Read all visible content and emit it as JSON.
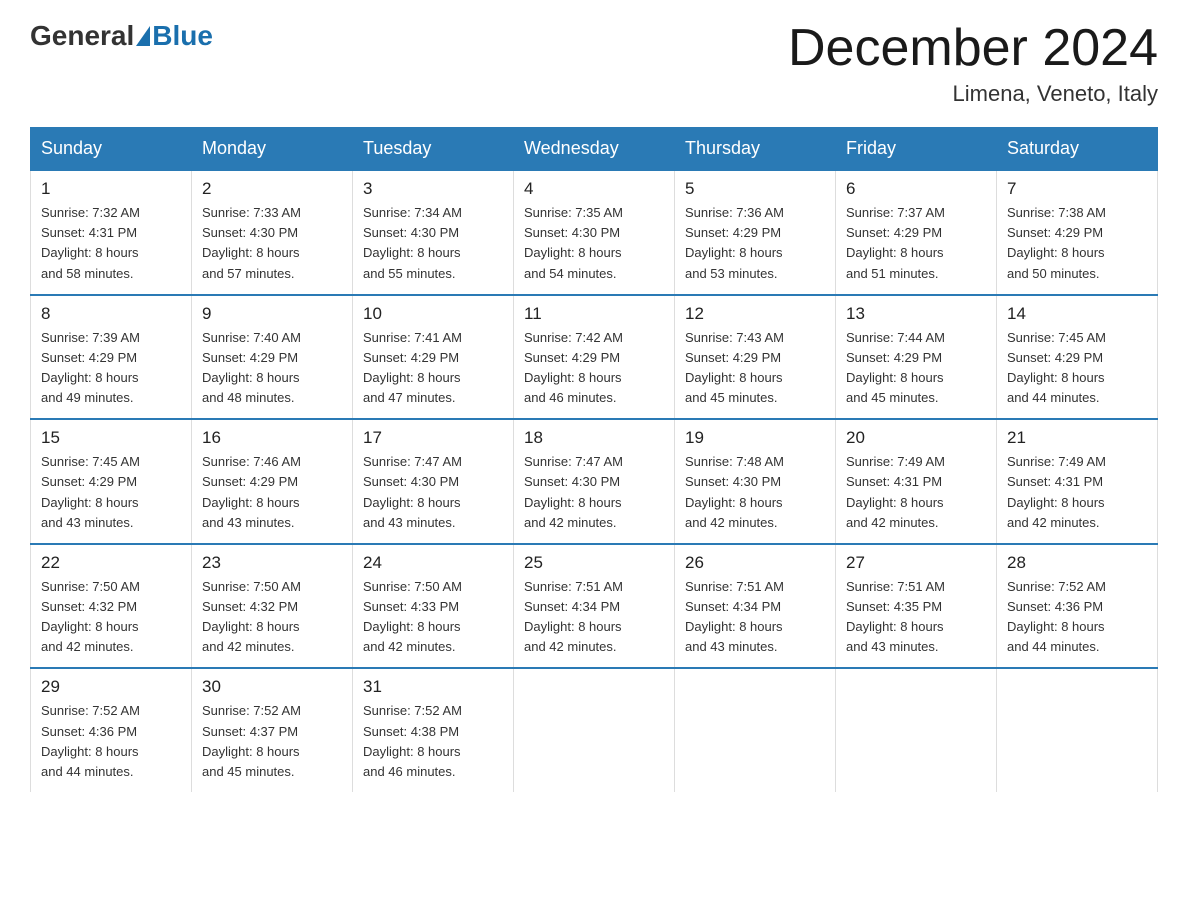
{
  "logo": {
    "general": "General",
    "blue": "Blue"
  },
  "header": {
    "title": "December 2024",
    "subtitle": "Limena, Veneto, Italy"
  },
  "days_of_week": [
    "Sunday",
    "Monday",
    "Tuesday",
    "Wednesday",
    "Thursday",
    "Friday",
    "Saturday"
  ],
  "weeks": [
    [
      {
        "day": "1",
        "sunrise": "7:32 AM",
        "sunset": "4:31 PM",
        "daylight": "8 hours and 58 minutes."
      },
      {
        "day": "2",
        "sunrise": "7:33 AM",
        "sunset": "4:30 PM",
        "daylight": "8 hours and 57 minutes."
      },
      {
        "day": "3",
        "sunrise": "7:34 AM",
        "sunset": "4:30 PM",
        "daylight": "8 hours and 55 minutes."
      },
      {
        "day": "4",
        "sunrise": "7:35 AM",
        "sunset": "4:30 PM",
        "daylight": "8 hours and 54 minutes."
      },
      {
        "day": "5",
        "sunrise": "7:36 AM",
        "sunset": "4:29 PM",
        "daylight": "8 hours and 53 minutes."
      },
      {
        "day": "6",
        "sunrise": "7:37 AM",
        "sunset": "4:29 PM",
        "daylight": "8 hours and 51 minutes."
      },
      {
        "day": "7",
        "sunrise": "7:38 AM",
        "sunset": "4:29 PM",
        "daylight": "8 hours and 50 minutes."
      }
    ],
    [
      {
        "day": "8",
        "sunrise": "7:39 AM",
        "sunset": "4:29 PM",
        "daylight": "8 hours and 49 minutes."
      },
      {
        "day": "9",
        "sunrise": "7:40 AM",
        "sunset": "4:29 PM",
        "daylight": "8 hours and 48 minutes."
      },
      {
        "day": "10",
        "sunrise": "7:41 AM",
        "sunset": "4:29 PM",
        "daylight": "8 hours and 47 minutes."
      },
      {
        "day": "11",
        "sunrise": "7:42 AM",
        "sunset": "4:29 PM",
        "daylight": "8 hours and 46 minutes."
      },
      {
        "day": "12",
        "sunrise": "7:43 AM",
        "sunset": "4:29 PM",
        "daylight": "8 hours and 45 minutes."
      },
      {
        "day": "13",
        "sunrise": "7:44 AM",
        "sunset": "4:29 PM",
        "daylight": "8 hours and 45 minutes."
      },
      {
        "day": "14",
        "sunrise": "7:45 AM",
        "sunset": "4:29 PM",
        "daylight": "8 hours and 44 minutes."
      }
    ],
    [
      {
        "day": "15",
        "sunrise": "7:45 AM",
        "sunset": "4:29 PM",
        "daylight": "8 hours and 43 minutes."
      },
      {
        "day": "16",
        "sunrise": "7:46 AM",
        "sunset": "4:29 PM",
        "daylight": "8 hours and 43 minutes."
      },
      {
        "day": "17",
        "sunrise": "7:47 AM",
        "sunset": "4:30 PM",
        "daylight": "8 hours and 43 minutes."
      },
      {
        "day": "18",
        "sunrise": "7:47 AM",
        "sunset": "4:30 PM",
        "daylight": "8 hours and 42 minutes."
      },
      {
        "day": "19",
        "sunrise": "7:48 AM",
        "sunset": "4:30 PM",
        "daylight": "8 hours and 42 minutes."
      },
      {
        "day": "20",
        "sunrise": "7:49 AM",
        "sunset": "4:31 PM",
        "daylight": "8 hours and 42 minutes."
      },
      {
        "day": "21",
        "sunrise": "7:49 AM",
        "sunset": "4:31 PM",
        "daylight": "8 hours and 42 minutes."
      }
    ],
    [
      {
        "day": "22",
        "sunrise": "7:50 AM",
        "sunset": "4:32 PM",
        "daylight": "8 hours and 42 minutes."
      },
      {
        "day": "23",
        "sunrise": "7:50 AM",
        "sunset": "4:32 PM",
        "daylight": "8 hours and 42 minutes."
      },
      {
        "day": "24",
        "sunrise": "7:50 AM",
        "sunset": "4:33 PM",
        "daylight": "8 hours and 42 minutes."
      },
      {
        "day": "25",
        "sunrise": "7:51 AM",
        "sunset": "4:34 PM",
        "daylight": "8 hours and 42 minutes."
      },
      {
        "day": "26",
        "sunrise": "7:51 AM",
        "sunset": "4:34 PM",
        "daylight": "8 hours and 43 minutes."
      },
      {
        "day": "27",
        "sunrise": "7:51 AM",
        "sunset": "4:35 PM",
        "daylight": "8 hours and 43 minutes."
      },
      {
        "day": "28",
        "sunrise": "7:52 AM",
        "sunset": "4:36 PM",
        "daylight": "8 hours and 44 minutes."
      }
    ],
    [
      {
        "day": "29",
        "sunrise": "7:52 AM",
        "sunset": "4:36 PM",
        "daylight": "8 hours and 44 minutes."
      },
      {
        "day": "30",
        "sunrise": "7:52 AM",
        "sunset": "4:37 PM",
        "daylight": "8 hours and 45 minutes."
      },
      {
        "day": "31",
        "sunrise": "7:52 AM",
        "sunset": "4:38 PM",
        "daylight": "8 hours and 46 minutes."
      },
      null,
      null,
      null,
      null
    ]
  ],
  "labels": {
    "sunrise": "Sunrise: ",
    "sunset": "Sunset: ",
    "daylight": "Daylight: "
  }
}
